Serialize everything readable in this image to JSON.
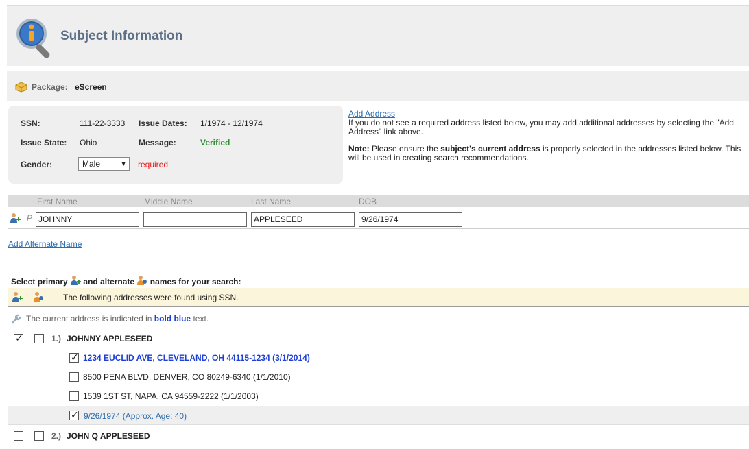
{
  "header": {
    "title": "Subject Information",
    "icon": "info-magnifier-icon"
  },
  "package": {
    "label": "Package:",
    "value": "eScreen",
    "icon": "package-box-icon"
  },
  "subject": {
    "ssn_label": "SSN:",
    "ssn_value": "111-22-3333",
    "issue_dates_label": "Issue Dates:",
    "issue_dates_value": "1/1974 - 12/1974",
    "issue_state_label": "Issue State:",
    "issue_state_value": "Ohio",
    "message_label": "Message:",
    "message_value": "Verified",
    "gender_label": "Gender:",
    "gender_value": "Male",
    "gender_required": "required"
  },
  "address_help": {
    "link": "Add Address",
    "text": "If you do not see a required address listed below, you may add additional addresses by selecting the \"Add Address\" link above.",
    "note_label": "Note:",
    "note_pre": " Please ensure the ",
    "note_bold": "subject's current address",
    "note_post": " is properly selected in the addresses listed below. This will be used in creating search recommendations."
  },
  "names_table": {
    "headers": [
      "First Name",
      "Middle Name",
      "Last Name",
      "DOB"
    ],
    "row": {
      "marker": "P",
      "first": "JOHNNY",
      "middle": "",
      "last": "APPLESEED",
      "dob": "9/26/1974"
    }
  },
  "add_alternate_name": "Add Alternate Name",
  "selection": {
    "title_pre": "Select primary",
    "title_mid": "and alternate",
    "title_post": "names for your search:",
    "found_text": "The following addresses were found using SSN.",
    "current_note_pre": "The current address is indicated in",
    "current_note_bold": "bold blue",
    "current_note_post": "text."
  },
  "results": [
    {
      "num": "1.)",
      "name": "JOHNNY APPLESEED",
      "primary_checked": true,
      "alternate_checked": false,
      "addresses": [
        {
          "text": "1234 EUCLID AVE, CLEVELAND, OH 44115-1234 (3/1/2014)",
          "checked": true,
          "current": true
        },
        {
          "text": "8500 PENA BLVD, DENVER, CO 80249-6340 (1/1/2010)",
          "checked": false,
          "current": false
        },
        {
          "text": "1539 1ST ST, NAPA, CA 94559-2222 (1/1/2003)",
          "checked": false,
          "current": false
        }
      ],
      "dob": {
        "text": "9/26/1974 (Approx. Age: 40)",
        "checked": true
      }
    },
    {
      "num": "2.)",
      "name": "JOHN Q APPLESEED",
      "primary_checked": false,
      "alternate_checked": false
    }
  ],
  "colors": {
    "link": "#2a6db0",
    "current_address": "#1d3fd6",
    "verified": "#2e8b2e",
    "required": "#e02020"
  }
}
